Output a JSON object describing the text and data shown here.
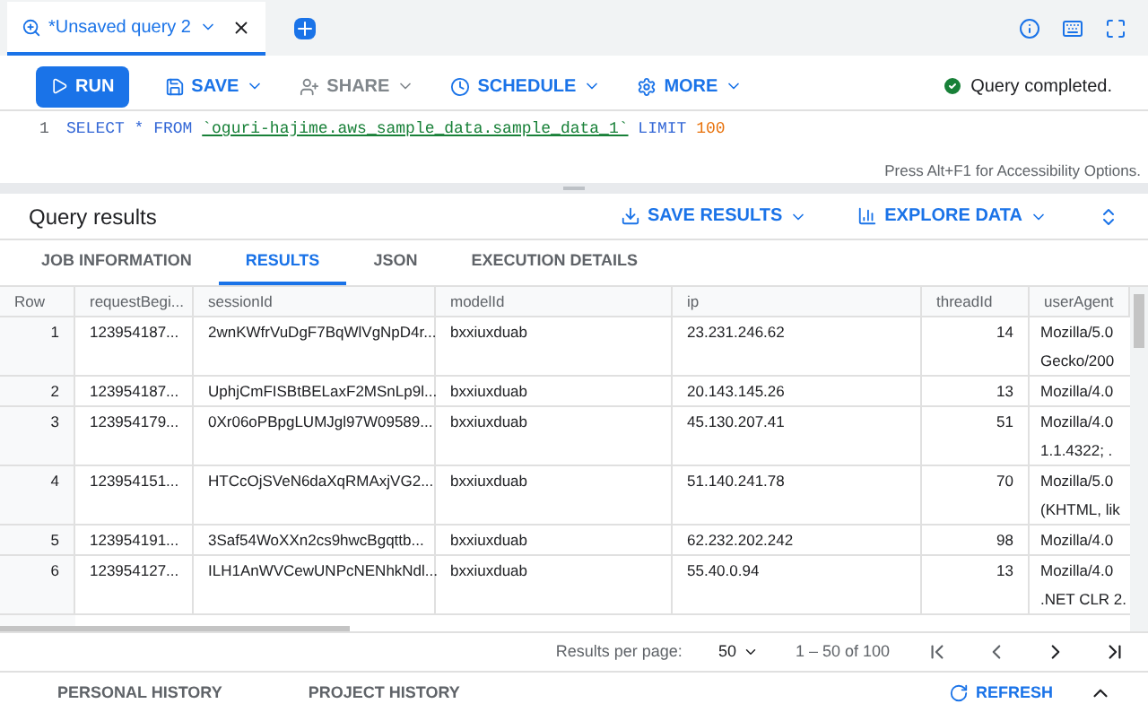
{
  "query_tab": {
    "title": "*Unsaved query 2",
    "selected": true
  },
  "toolbar": {
    "run": "RUN",
    "save": "SAVE",
    "share": "SHARE",
    "schedule": "SCHEDULE",
    "more": "MORE",
    "status": "Query completed."
  },
  "editor": {
    "line_number": "1",
    "sql": [
      {
        "kind": "keyword",
        "text": "SELECT * FROM "
      },
      {
        "kind": "table",
        "text": "`oguri-hajime.aws_sample_data.sample_data_1`"
      },
      {
        "kind": "keyword",
        "text": " LIMIT "
      },
      {
        "kind": "number",
        "text": "100"
      }
    ],
    "hint": "Press Alt+F1 for Accessibility Options."
  },
  "results": {
    "title": "Query results",
    "save_results": "SAVE RESULTS",
    "explore_data": "EXPLORE DATA"
  },
  "tabs": [
    {
      "label": "JOB INFORMATION",
      "selected": false
    },
    {
      "label": "RESULTS",
      "selected": true
    },
    {
      "label": "JSON",
      "selected": false
    },
    {
      "label": "EXECUTION DETAILS",
      "selected": false
    }
  ],
  "table": {
    "columns": [
      "Row",
      "requestBegi...",
      "sessionId",
      "modelId",
      "ip",
      "threadId",
      "userAgent"
    ],
    "rows": [
      {
        "row": "1",
        "requestBegin": "123954187...",
        "sessionId": "2wnKWfrVuDgF7BqWlVgNpD4r...",
        "modelId": "bxxiuxduab",
        "ip": "23.231.246.62",
        "threadId": "14",
        "userAgent": [
          "Mozilla/5.0",
          "Gecko/200"
        ]
      },
      {
        "row": "2",
        "requestBegin": "123954187...",
        "sessionId": "UphjCmFISBtBELaxF2MSnLp9l...",
        "modelId": "bxxiuxduab",
        "ip": "20.143.145.26",
        "threadId": "13",
        "userAgent": [
          "Mozilla/4.0"
        ]
      },
      {
        "row": "3",
        "requestBegin": "123954179...",
        "sessionId": "0Xr06oPBpgLUMJgl97W09589...",
        "modelId": "bxxiuxduab",
        "ip": "45.130.207.41",
        "threadId": "51",
        "userAgent": [
          "Mozilla/4.0",
          "1.1.4322; ."
        ]
      },
      {
        "row": "4",
        "requestBegin": "123954151...",
        "sessionId": "HTCcOjSVeN6daXqRMAxjVG2...",
        "modelId": "bxxiuxduab",
        "ip": "51.140.241.78",
        "threadId": "70",
        "userAgent": [
          "Mozilla/5.0",
          "(KHTML, lik"
        ]
      },
      {
        "row": "5",
        "requestBegin": "123954191...",
        "sessionId": "3Saf54WoXXn2cs9hwcBgqttb...",
        "modelId": "bxxiuxduab",
        "ip": "62.232.202.242",
        "threadId": "98",
        "userAgent": [
          "Mozilla/4.0"
        ]
      },
      {
        "row": "6",
        "requestBegin": "123954127...",
        "sessionId": "ILH1AnWVCewUNPcNENhkNdl...",
        "modelId": "bxxiuxduab",
        "ip": "55.40.0.94",
        "threadId": "13",
        "userAgent": [
          "Mozilla/4.0",
          ".NET CLR 2."
        ]
      }
    ]
  },
  "pagination": {
    "label": "Results per page:",
    "per_page": "50",
    "range": "1 – 50 of 100"
  },
  "history": {
    "tabs": [
      "PERSONAL HISTORY",
      "PROJECT HISTORY"
    ],
    "refresh": "REFRESH"
  }
}
